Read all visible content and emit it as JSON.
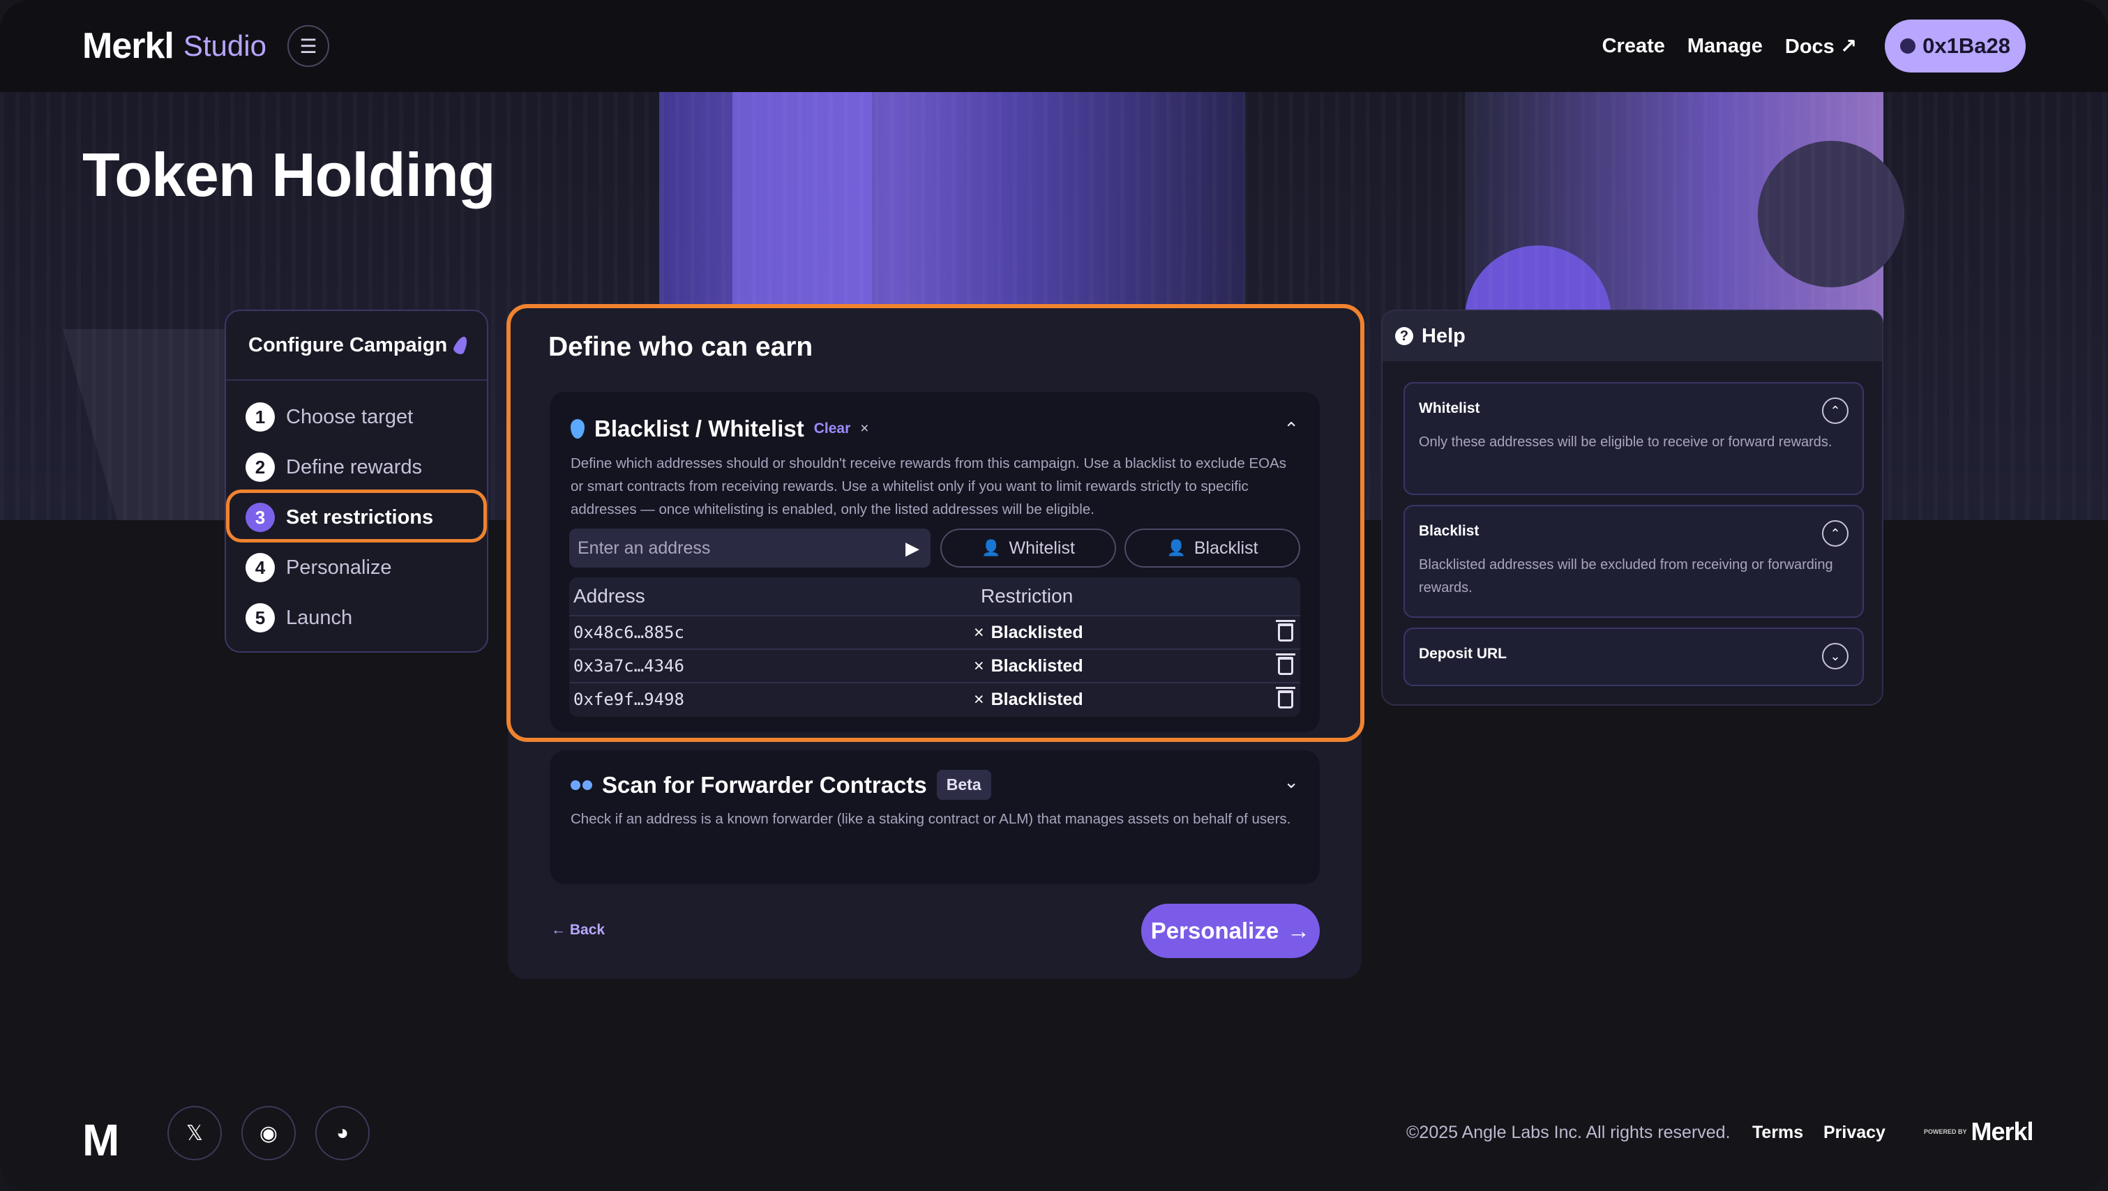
{
  "header": {
    "logo": "Merkl",
    "logo_sub": "Studio",
    "nav": [
      "Create",
      "Manage",
      "Docs ↗"
    ],
    "wallet": "0x1Ba28"
  },
  "hero": {
    "title": "Token Holding"
  },
  "stepper": {
    "title": "Configure Campaign",
    "steps": [
      {
        "num": "1",
        "label": "Choose target"
      },
      {
        "num": "2",
        "label": "Define rewards"
      },
      {
        "num": "3",
        "label": "Set restrictions"
      },
      {
        "num": "4",
        "label": "Personalize"
      },
      {
        "num": "5",
        "label": "Launch"
      }
    ],
    "active_step": 3
  },
  "main": {
    "title": "Define who can earn",
    "blacklist": {
      "title": "Blacklist / Whitelist",
      "clear": "Clear",
      "description": "Define which addresses should or shouldn't receive rewards from this campaign. Use a blacklist to exclude EOAs or smart contracts from receiving rewards. Use a whitelist only if you want to limit rewards strictly to specific addresses — once whitelisting is enabled, only the listed addresses will be eligible.",
      "input_placeholder": "Enter an address",
      "whitelist_btn": "Whitelist",
      "blacklist_btn": "Blacklist",
      "columns": [
        "Address",
        "Restriction"
      ],
      "rows": [
        {
          "address": "0x48c6…885c",
          "restriction": "Blacklisted"
        },
        {
          "address": "0x3a7c…4346",
          "restriction": "Blacklisted"
        },
        {
          "address": "0xfe9f…9498",
          "restriction": "Blacklisted"
        }
      ]
    },
    "scanner": {
      "title": "Scan for Forwarder Contracts",
      "badge": "Beta",
      "description": "Check if an address is a known forwarder (like a staking contract or ALM) that manages assets on behalf of users."
    },
    "back": "Back",
    "next": "Personalize"
  },
  "help": {
    "title": "Help",
    "items": [
      {
        "title": "Whitelist",
        "desc": "Only these addresses will be eligible to receive or forward rewards.",
        "expanded": true
      },
      {
        "title": "Blacklist",
        "desc": "Blacklisted addresses will be excluded from receiving or forwarding rewards.",
        "expanded": true
      },
      {
        "title": "Deposit URL",
        "desc": "",
        "expanded": false
      }
    ]
  },
  "footer": {
    "logo": "M",
    "copyright": "©2025 Angle Labs Inc. All rights reserved.",
    "terms": "Terms",
    "privacy": "Privacy",
    "powered_by": "POWERED BY",
    "powered_brand": "Merkl",
    "social": [
      "x-icon",
      "github-icon",
      "discord-icon"
    ]
  },
  "colors": {
    "accent": "#7a5ce8",
    "highlight": "#f0832f",
    "wallet_bg": "#b8a6ff"
  }
}
